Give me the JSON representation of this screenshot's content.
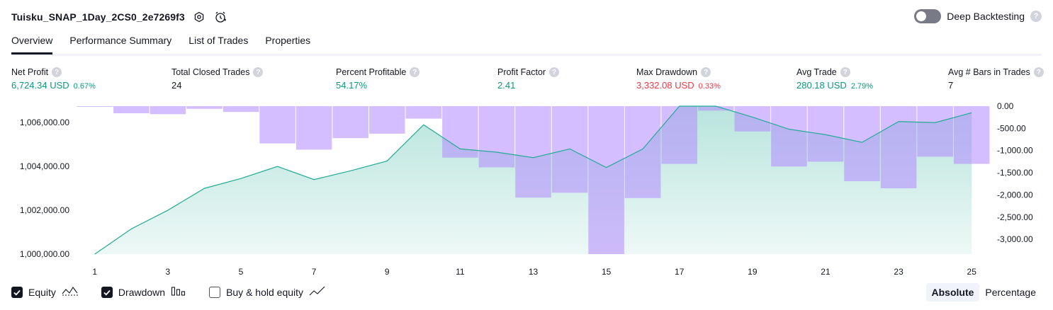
{
  "header": {
    "title": "Tuisku_SNAP_1Day_2CS0_2e7269f3",
    "deep_backtesting_label": "Deep Backtesting"
  },
  "tabs": [
    "Overview",
    "Performance Summary",
    "List of Trades",
    "Properties"
  ],
  "metrics": {
    "net_profit": {
      "label": "Net Profit",
      "value": "6,724.34 USD",
      "pct": "0.67%"
    },
    "total_closed_trades": {
      "label": "Total Closed Trades",
      "value": "24"
    },
    "percent_profitable": {
      "label": "Percent Profitable",
      "value": "54.17%"
    },
    "profit_factor": {
      "label": "Profit Factor",
      "value": "2.41"
    },
    "max_drawdown": {
      "label": "Max Drawdown",
      "value": "3,332.08 USD",
      "pct": "0.33%"
    },
    "avg_trade": {
      "label": "Avg Trade",
      "value": "280.18 USD",
      "pct": "2.79%"
    },
    "avg_bars": {
      "label": "Avg # Bars in Trades",
      "value": "7"
    }
  },
  "colors": {
    "green": "#089981",
    "red": "#f23645",
    "equity_line": "#22ab94",
    "drawdown_fill": "#b388ff"
  },
  "legend": {
    "equity": "Equity",
    "drawdown": "Drawdown",
    "buy_hold": "Buy & hold equity",
    "equity_checked": true,
    "drawdown_checked": true,
    "buy_hold_checked": false
  },
  "scale_toggle": {
    "absolute": "Absolute",
    "percentage": "Percentage",
    "selected": "Absolute"
  },
  "chart_data": {
    "type": "line",
    "x": [
      1,
      2,
      3,
      4,
      5,
      6,
      7,
      8,
      9,
      10,
      11,
      12,
      13,
      14,
      15,
      16,
      17,
      18,
      19,
      20,
      21,
      22,
      23,
      24,
      25
    ],
    "x_tick_labels": [
      "1",
      "3",
      "5",
      "7",
      "9",
      "11",
      "13",
      "15",
      "17",
      "19",
      "21",
      "23",
      "25"
    ],
    "series": [
      {
        "name": "Equity",
        "axis": "left",
        "values": [
          1000000,
          1001150,
          1002000,
          1003000,
          1003450,
          1004000,
          1003400,
          1003800,
          1004250,
          1005900,
          1004800,
          1004650,
          1004400,
          1004800,
          1003950,
          1004800,
          1006750,
          1006750,
          1006250,
          1005700,
          1005450,
          1005100,
          1006050,
          1006000,
          1006450
        ]
      },
      {
        "name": "Drawdown",
        "axis": "right",
        "type": "bar",
        "values": [
          -10,
          -160,
          -180,
          -60,
          -130,
          -840,
          -980,
          -720,
          -620,
          -280,
          -1160,
          -1380,
          -2060,
          -1950,
          -3332.08,
          -2070,
          -1300,
          -100,
          -570,
          -1360,
          -1250,
          -1690,
          -1850,
          -1140,
          -1300
        ]
      }
    ],
    "left_axis_ticks": [
      "1,000,000.00",
      "1,002,000.00",
      "1,004,000.00",
      "1,006,000.00"
    ],
    "left_ylim": [
      1000000,
      1006750
    ],
    "right_axis_ticks": [
      "0.00",
      "-500.00",
      "-1,000.00",
      "-1,500.00",
      "-2,000.00",
      "-2,500.00",
      "-3,000.00"
    ],
    "right_ylim": [
      -3332.08,
      0
    ]
  }
}
